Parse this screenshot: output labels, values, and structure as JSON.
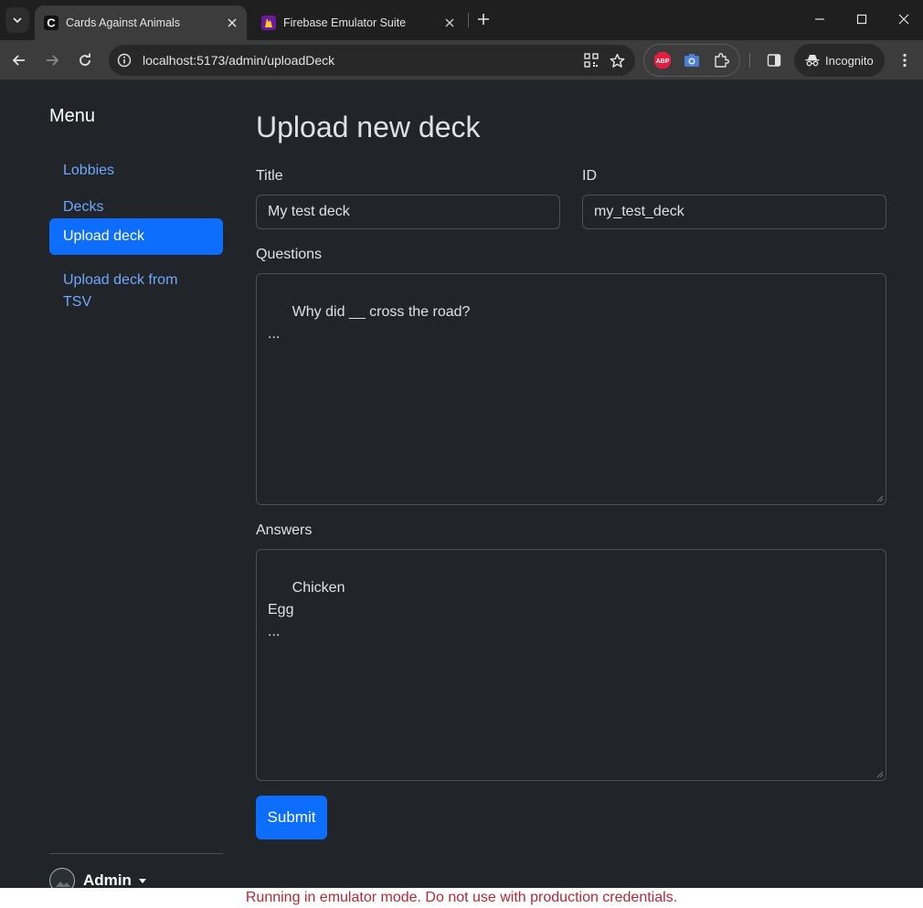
{
  "browser": {
    "tabs": [
      {
        "title": "Cards Against Animals",
        "favicon": "C",
        "active": true
      },
      {
        "title": "Firebase Emulator Suite",
        "favicon": "firebase-icon",
        "active": false
      }
    ],
    "url": "localhost:5173/admin/uploadDeck",
    "profile_label": "Incognito",
    "extensions": [
      "adblock-plus-icon",
      "camera-icon",
      "puzzle-icon"
    ]
  },
  "sidebar": {
    "title": "Menu",
    "items": [
      {
        "label": "Lobbies",
        "active": false
      },
      {
        "label": "Decks",
        "active": false
      },
      {
        "label": "Upload deck",
        "active": true
      },
      {
        "label": "Upload deck from TSV",
        "active": false
      }
    ],
    "user": {
      "name": "Admin"
    }
  },
  "main": {
    "title": "Upload new deck",
    "fields": {
      "title_label": "Title",
      "title_value": "My test deck",
      "id_label": "ID",
      "id_value": "my_test_deck",
      "questions_label": "Questions",
      "questions_value": "Why did __ cross the road?\n...",
      "answers_label": "Answers",
      "answers_value": "Chicken\nEgg\n..."
    },
    "submit_label": "Submit"
  },
  "footer": {
    "warning": "Running in emulator mode. Do not use with production credentials."
  },
  "colors": {
    "accent": "#0d6efd",
    "link": "#6ea8fe",
    "background": "#212529",
    "warning_text": "#b02a37"
  }
}
